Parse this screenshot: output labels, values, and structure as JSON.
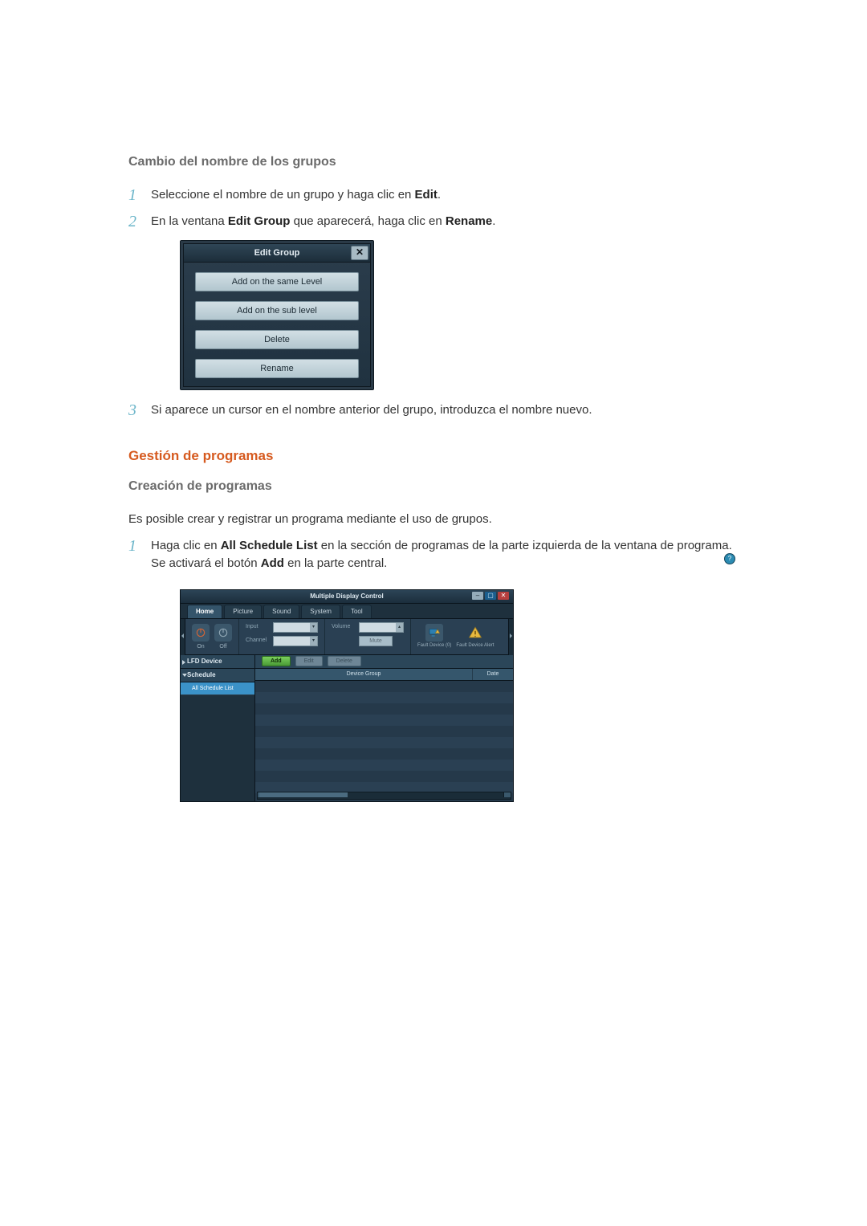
{
  "section1": {
    "heading": "Cambio del nombre de los grupos",
    "step1_a": "Seleccione el nombre de un grupo y haga clic en ",
    "step1_b": "Edit",
    "step1_c": ".",
    "step2_a": "En la ventana ",
    "step2_b": "Edit Group",
    "step2_c": " que aparecerá, haga clic en ",
    "step2_d": "Rename",
    "step2_e": ".",
    "step3": "Si aparece un cursor en el nombre anterior del grupo, introduzca el nombre nuevo."
  },
  "dialog": {
    "title": "Edit Group",
    "close": "✕",
    "btn1": "Add on the same Level",
    "btn2": "Add on the sub level",
    "btn3": "Delete",
    "btn4": "Rename"
  },
  "section2": {
    "heading": "Gestión de programas",
    "subheading": "Creación de programas",
    "para": "Es posible crear y registrar un programa mediante el uso de grupos.",
    "step1_a": "Haga clic en ",
    "step1_b": "All Schedule List",
    "step1_c": " en la sección de programas de la parte izquierda de la ventana de programa. Se activará el botón ",
    "step1_d": "Add",
    "step1_e": " en la parte central."
  },
  "mdc": {
    "title": "Multiple Display Control",
    "help": "?",
    "win_min": "–",
    "win_max": "▢",
    "win_close": "✕",
    "tabs": {
      "home": "Home",
      "picture": "Picture",
      "sound": "Sound",
      "system": "System",
      "tool": "Tool"
    },
    "ribbon": {
      "on": "On",
      "off": "Off",
      "input_label": "Input",
      "channel_label": "Channel",
      "volume_label": "Volume",
      "mute": "Mute",
      "fault1": "Fault Device (0)",
      "fault2": "Fault Device Alert"
    },
    "sidebar": {
      "lfd": "LFD Device",
      "schedule": "Schedule",
      "all_schedule": "All Schedule List"
    },
    "toolbar": {
      "add": "Add",
      "edit": "Edit",
      "delete": "Delete"
    },
    "grid": {
      "col1": "Device Group",
      "col2": "Date"
    }
  }
}
